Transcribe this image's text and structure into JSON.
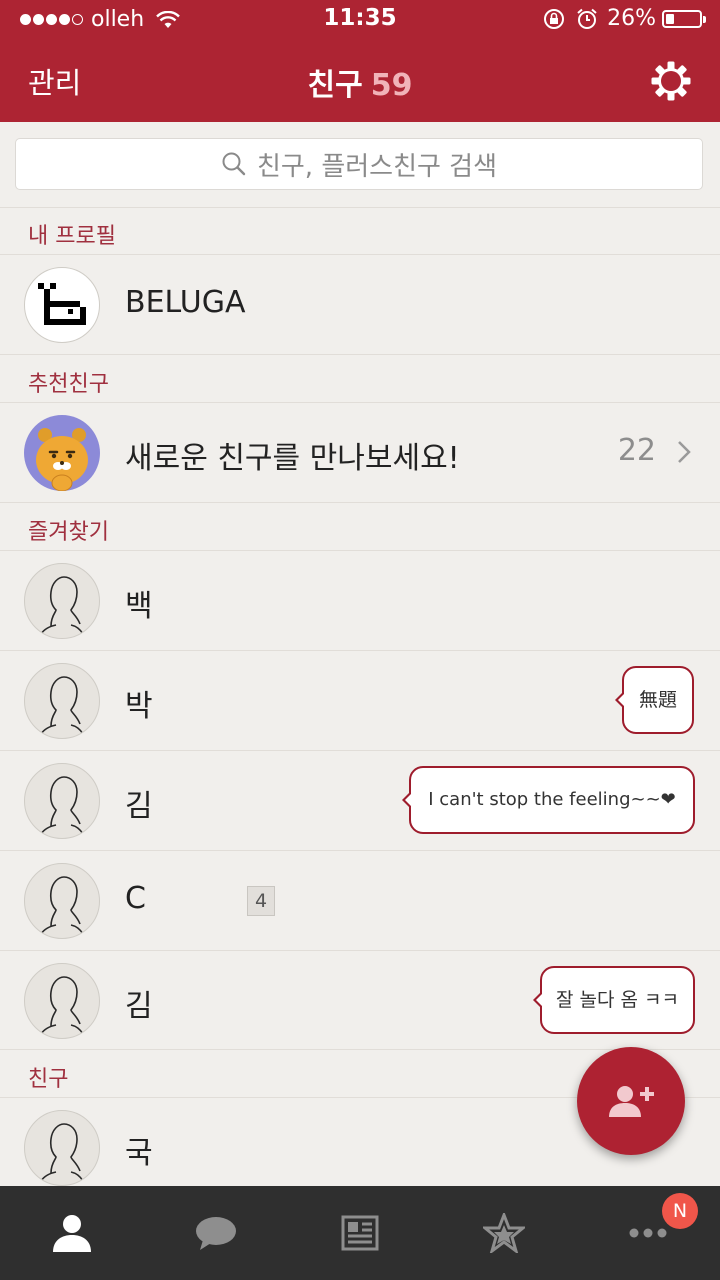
{
  "status_bar": {
    "carrier": "olleh",
    "time": "11:35",
    "battery_text": "26%",
    "battery_level": 0.26,
    "signal_bars_filled": 4,
    "signal_bars_total": 5
  },
  "nav": {
    "left_button": "관리",
    "title": "친구",
    "friend_count": "59",
    "settings_icon": "gear-icon"
  },
  "search": {
    "placeholder": "친구, 플러스친구 검색"
  },
  "sections": {
    "my_profile": "내 프로필",
    "recommended": "추천친구",
    "favorites": "즐겨찾기",
    "friends": "친구"
  },
  "my_profile": {
    "name": "BELUGA"
  },
  "recommended_row": {
    "text": "새로운 친구를 만나보세요!",
    "count": "22"
  },
  "favorites": [
    {
      "name": "백",
      "status": ""
    },
    {
      "name": "박",
      "status": "無題"
    },
    {
      "name": "김",
      "status": "I can't stop the feeling~~❤"
    },
    {
      "name": "C",
      "badge": "4",
      "status": ""
    },
    {
      "name": "김",
      "status": "잘 놀다 옴 ㅋㅋ"
    }
  ],
  "friends": [
    {
      "name": "국"
    }
  ],
  "tabbar": {
    "tabs": [
      "friends-icon",
      "chat-icon",
      "news-icon",
      "star-icon",
      "more-icon"
    ],
    "more_badge": "N"
  },
  "colors": {
    "header": "#ad2433",
    "section_text": "#a0303f",
    "tabbar": "#2f2f2f",
    "badge": "#f0564a"
  }
}
